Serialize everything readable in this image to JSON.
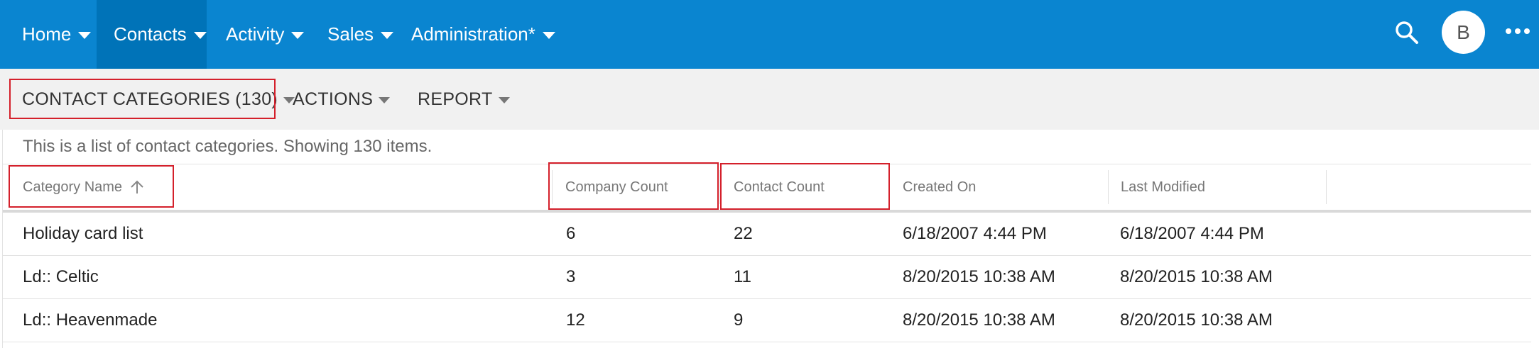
{
  "nav": {
    "items": [
      {
        "label": "Home"
      },
      {
        "label": "Contacts"
      },
      {
        "label": "Activity"
      },
      {
        "label": "Sales"
      },
      {
        "label": "Administration*"
      }
    ],
    "active": "Contacts",
    "search_icon": "search-icon",
    "avatar_initial": "B",
    "more_icon": "more-horizontal-icon"
  },
  "toolbar": {
    "view_selector": "CONTACT CATEGORIES (130)",
    "actions": "ACTIONS",
    "report": "REPORT"
  },
  "list": {
    "description": "This is a list of contact categories. Showing 130 items.",
    "columns": [
      "Category Name",
      "Company Count",
      "Contact Count",
      "Created On",
      "Last Modified"
    ],
    "sort": {
      "column": "Category Name",
      "direction": "ascending",
      "icon": "arrow-up-icon"
    },
    "rows": [
      {
        "name": "Holiday card list",
        "company_count": "6",
        "contact_count": "22",
        "created_on": "6/18/2007 4:44 PM",
        "last_modified": "6/18/2007 4:44 PM"
      },
      {
        "name": "Ld:: Celtic",
        "company_count": "3",
        "contact_count": "11",
        "created_on": "8/20/2015 10:38 AM",
        "last_modified": "8/20/2015 10:38 AM"
      },
      {
        "name": "Ld:: Heavenmade",
        "company_count": "12",
        "contact_count": "9",
        "created_on": "8/20/2015 10:38 AM",
        "last_modified": "8/20/2015 10:38 AM"
      }
    ]
  },
  "colors": {
    "nav_background": "#0a85d0",
    "nav_active": "#0073b8",
    "highlight_border": "#d4202b",
    "toolbar_background": "#f1f1f1"
  }
}
